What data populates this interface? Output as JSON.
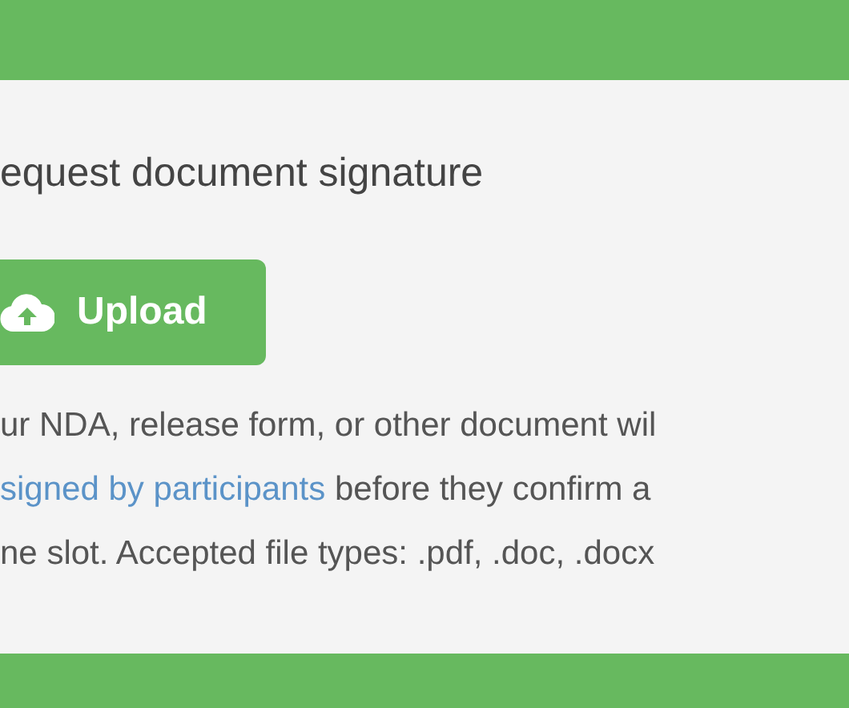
{
  "title": "equest document signature",
  "upload_button": {
    "label": "Upload"
  },
  "description": {
    "lines": [
      {
        "text": "ur NDA, release form, or other document wil"
      },
      {
        "link": "signed by participants",
        "text": " before they confirm a"
      },
      {
        "text": "ne slot. Accepted file types: .pdf, .doc, .docx"
      }
    ]
  }
}
